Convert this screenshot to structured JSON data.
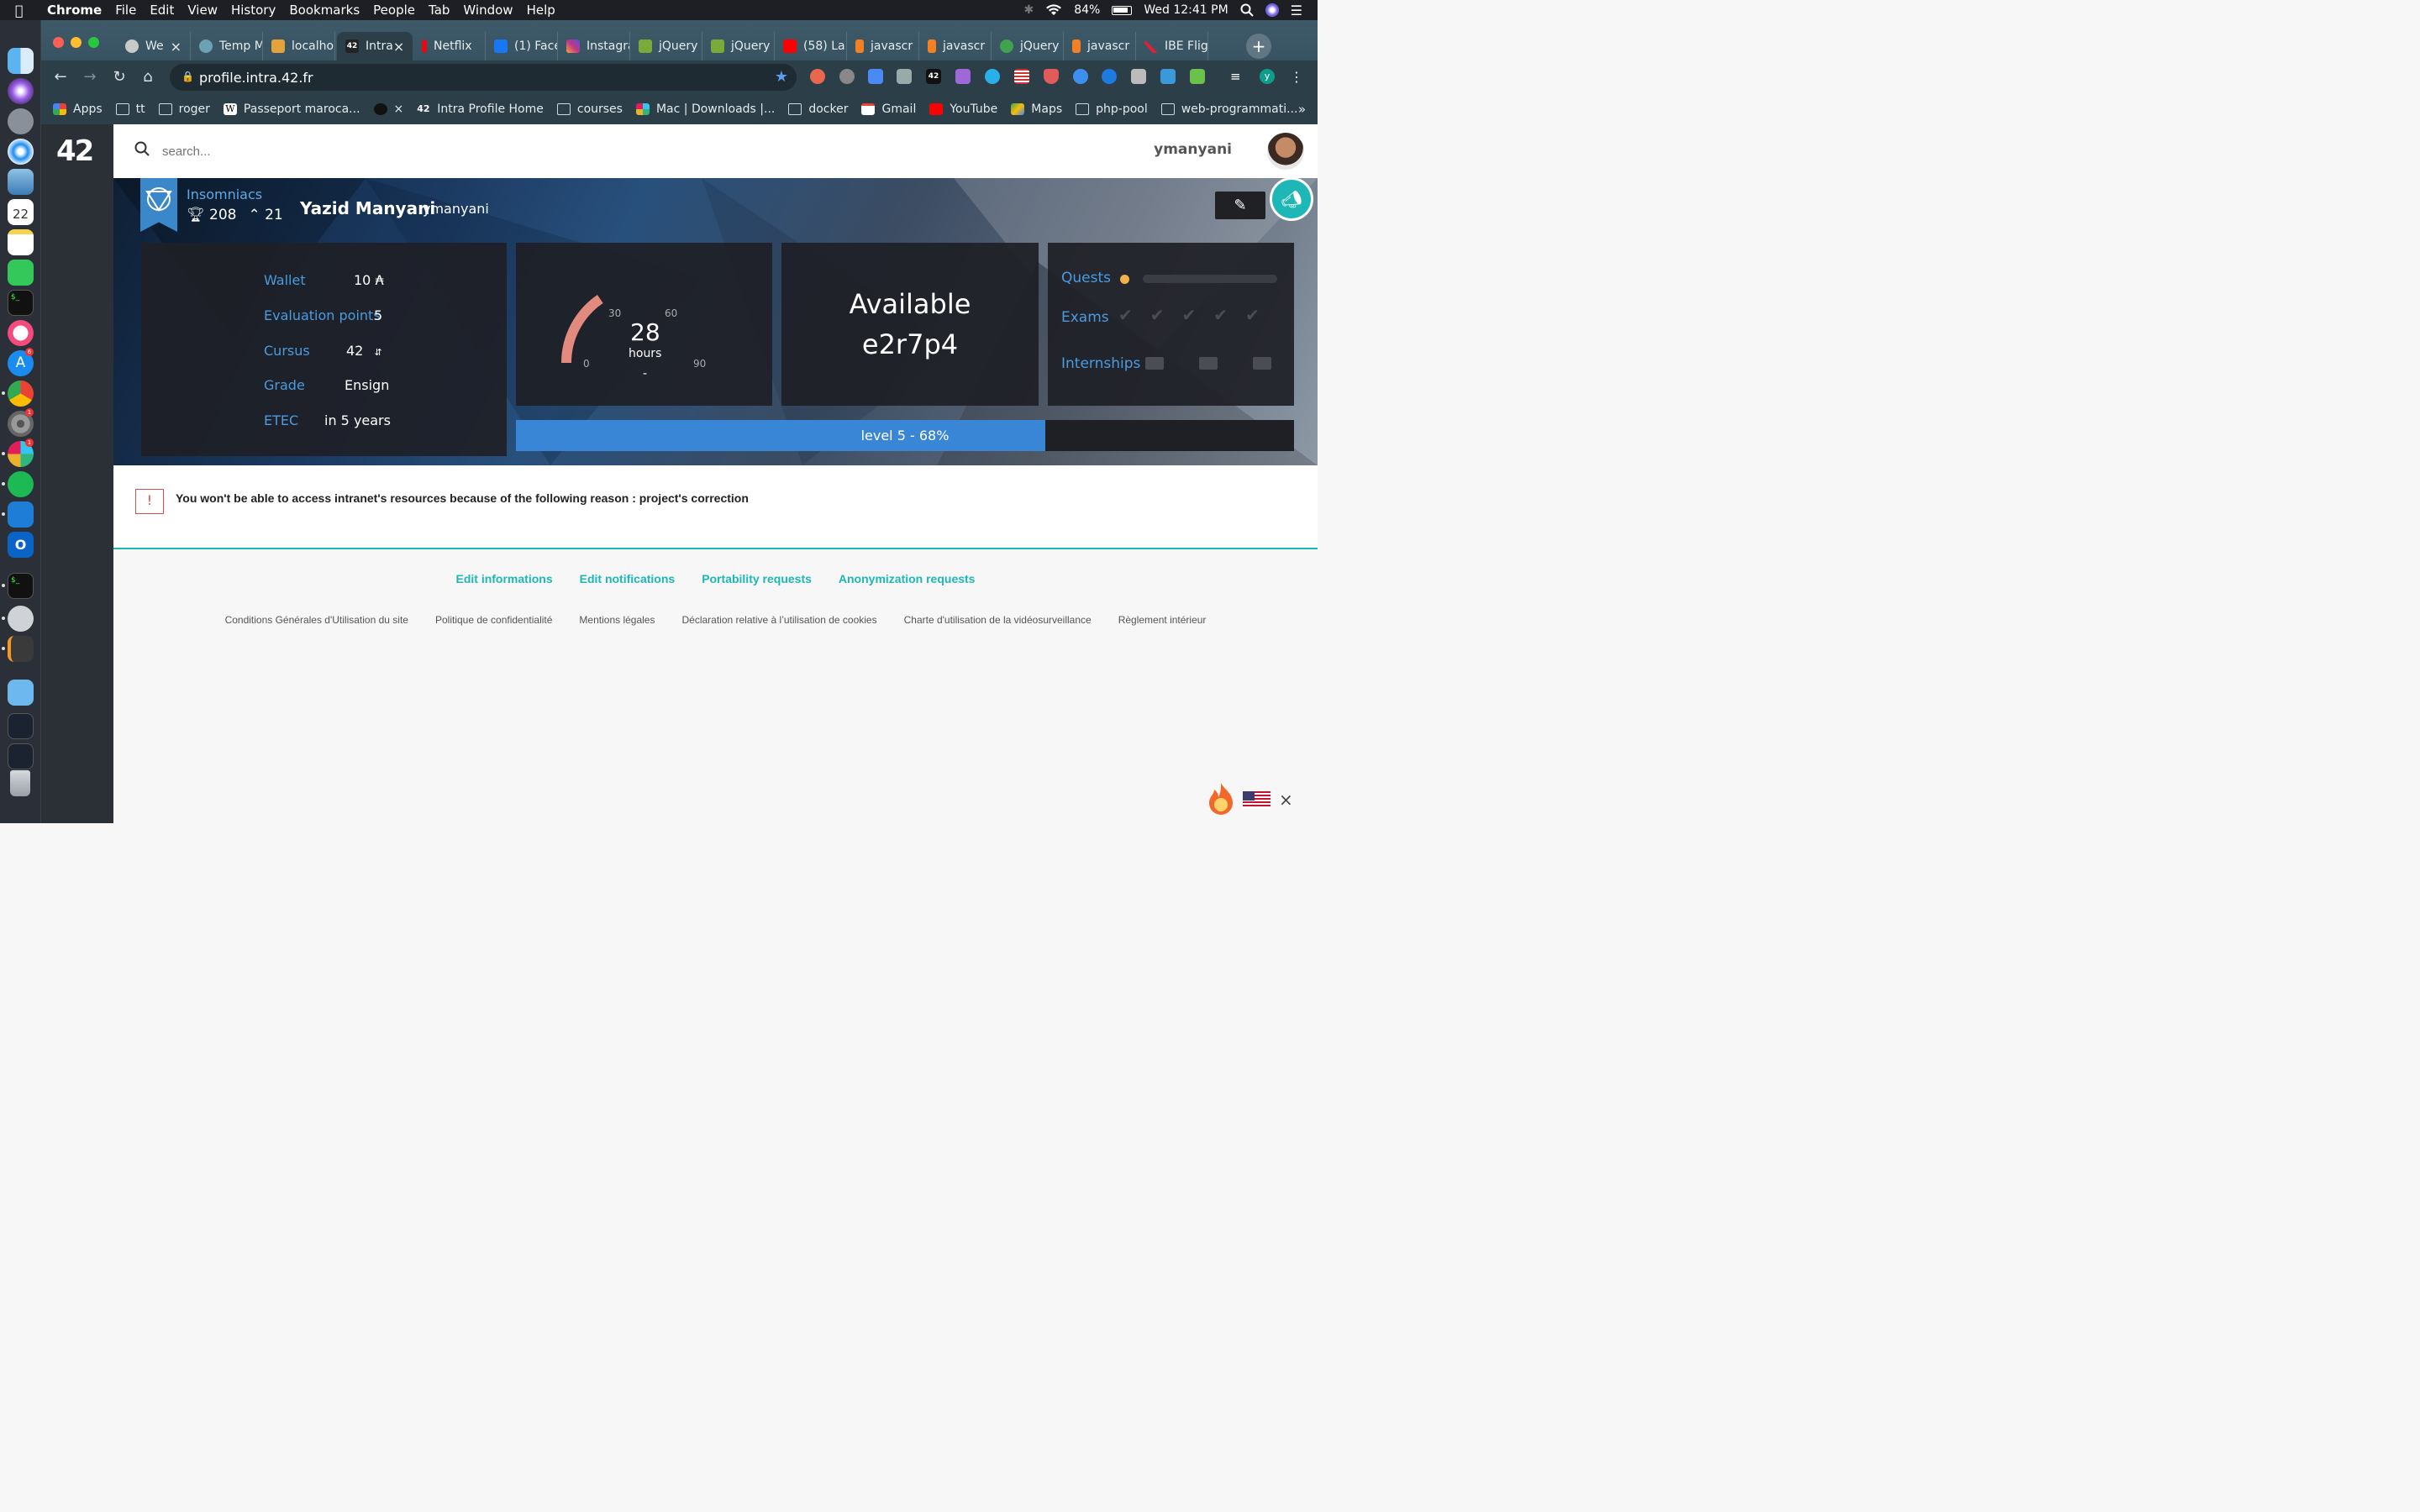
{
  "menubar": {
    "app": "Chrome",
    "items": [
      "File",
      "Edit",
      "View",
      "History",
      "Bookmarks",
      "People",
      "Tab",
      "Window",
      "Help"
    ],
    "battery": "84%",
    "clock": "Wed 12:41 PM"
  },
  "dock": {
    "calendar_day": "22",
    "badges": [
      "6",
      "1",
      "1"
    ]
  },
  "tabs": [
    {
      "label": "We",
      "color": "#c9c9c9"
    },
    {
      "label": "Temp M",
      "color": "#6ba3b5"
    },
    {
      "label": "localho",
      "color": "#e3a23b"
    },
    {
      "label": "Intra",
      "color": "#222"
    },
    {
      "label": "Netflix",
      "color": "#e50914"
    },
    {
      "label": "(1) Face",
      "color": "#1877f2"
    },
    {
      "label": "Instagra",
      "color": "#c13584"
    },
    {
      "label": "jQuery",
      "color": "#7aab3a"
    },
    {
      "label": "jQuery",
      "color": "#7aab3a"
    },
    {
      "label": "(58) La",
      "color": "#ff0000"
    },
    {
      "label": "javascr",
      "color": "#f48024"
    },
    {
      "label": "javascr",
      "color": "#f48024"
    },
    {
      "label": "jQuery",
      "color": "#3fa34d"
    },
    {
      "label": "javascr",
      "color": "#f48024"
    },
    {
      "label": "IBE Flig",
      "color": "#e0203a"
    }
  ],
  "omnibox": {
    "url": "profile.intra.42.fr"
  },
  "bookmarks": [
    {
      "label": "Apps",
      "type": "apps"
    },
    {
      "label": "tt",
      "type": "folder"
    },
    {
      "label": "roger",
      "type": "folder"
    },
    {
      "label": "Passeport maroca...",
      "type": "wiki"
    },
    {
      "label": "×",
      "type": "globe"
    },
    {
      "label": "Intra Profile Home",
      "type": "intra"
    },
    {
      "label": "courses",
      "type": "folder"
    },
    {
      "label": "Mac | Downloads |...",
      "type": "slack"
    },
    {
      "label": "docker",
      "type": "folder"
    },
    {
      "label": "Gmail",
      "type": "gmail"
    },
    {
      "label": "YouTube",
      "type": "youtube"
    },
    {
      "label": "Maps",
      "type": "maps"
    },
    {
      "label": "php-pool",
      "type": "folder"
    },
    {
      "label": "web-programmati...",
      "type": "folder"
    }
  ],
  "bookmarks_more": "»",
  "site": {
    "logo": "42",
    "search_placeholder": "search...",
    "login": "ymanyani"
  },
  "profile": {
    "coalition": "Insomniacs",
    "coalition_score": "208",
    "coalition_rank": "21",
    "full_name": "Yazid Manyani",
    "login": "ymanyani",
    "info": [
      {
        "label": "Wallet",
        "value": "10 ₳"
      },
      {
        "label": "Evaluation points",
        "value": "5"
      },
      {
        "label": "Cursus",
        "value": "42"
      },
      {
        "label": "Grade",
        "value": "Ensign"
      },
      {
        "label": "ETEC",
        "value": "in 5 years"
      }
    ],
    "logtime": {
      "hours": "28",
      "unit": "hours",
      "sub": "-",
      "ticks": [
        "0",
        "30",
        "60",
        "90"
      ],
      "fraction_of_90": 0.31
    },
    "location": {
      "status": "Available",
      "host": "e2r7p4"
    },
    "achievements": {
      "quests_label": "Quests",
      "exams_label": "Exams",
      "internships_label": "Internships",
      "exam_checks": 5,
      "internship_icons": 3
    },
    "level": {
      "text": "level 5 - 68%",
      "progress": 0.68
    }
  },
  "alert": {
    "text": "You won't be able to access intranet's resources because of the following reason : project's correction"
  },
  "footer": {
    "links": [
      "Edit informations",
      "Edit notifications",
      "Portability requests",
      "Anonymization requests"
    ],
    "legal": [
      "Conditions Générales d'Utilisation du site",
      "Politique de confidentialité",
      "Mentions légales",
      "Déclaration relative à l’utilisation de cookies",
      "Charte d'utilisation de la vidéosurveillance",
      "Règlement intérieur"
    ]
  },
  "colors": {
    "accent_blue": "#3a86d6",
    "label_blue": "#4a9be0",
    "teal": "#1fb6b6",
    "gauge": "#e38a7e",
    "quest_dot": "#f0b14a"
  }
}
